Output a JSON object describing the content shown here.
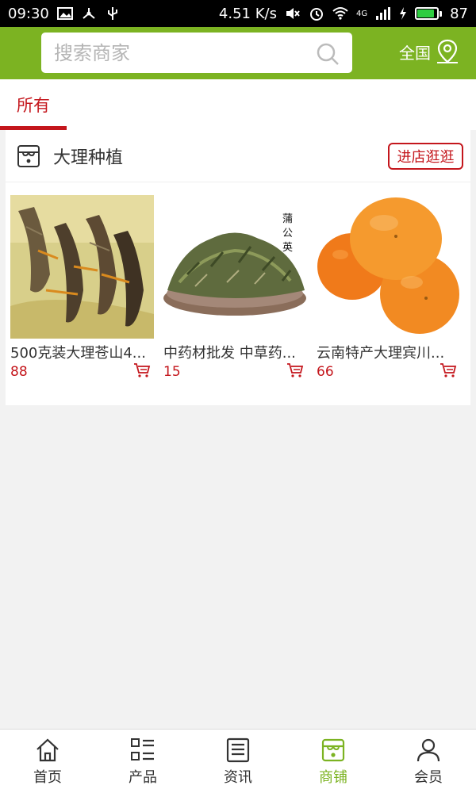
{
  "status_bar": {
    "time": "09:30",
    "speed": "4.51 K/s",
    "network": "4G",
    "battery": "87",
    "battery_level": 0.87
  },
  "header": {
    "search_placeholder": "搜索商家",
    "region_label": "全国"
  },
  "tabs": [
    {
      "label": "所有",
      "active": true
    }
  ],
  "shop": {
    "name": "大理种植",
    "visit_label": "进店逛逛",
    "products": [
      {
        "title": "500克装大理苍山4...",
        "price": "88"
      },
      {
        "title": "中药材批发 中草药...",
        "price": "15",
        "image_text": "蒲公英"
      },
      {
        "title": "云南特产大理宾川...",
        "price": "66"
      }
    ]
  },
  "bottom_nav": [
    {
      "label": "首页",
      "icon": "home-icon",
      "active": false
    },
    {
      "label": "产品",
      "icon": "grid-list-icon",
      "active": false
    },
    {
      "label": "资讯",
      "icon": "news-icon",
      "active": false
    },
    {
      "label": "商铺",
      "icon": "store-icon",
      "active": true
    },
    {
      "label": "会员",
      "icon": "user-icon",
      "active": false
    }
  ],
  "colors": {
    "brand_green": "#7cb322",
    "accent_red": "#c4161c"
  }
}
